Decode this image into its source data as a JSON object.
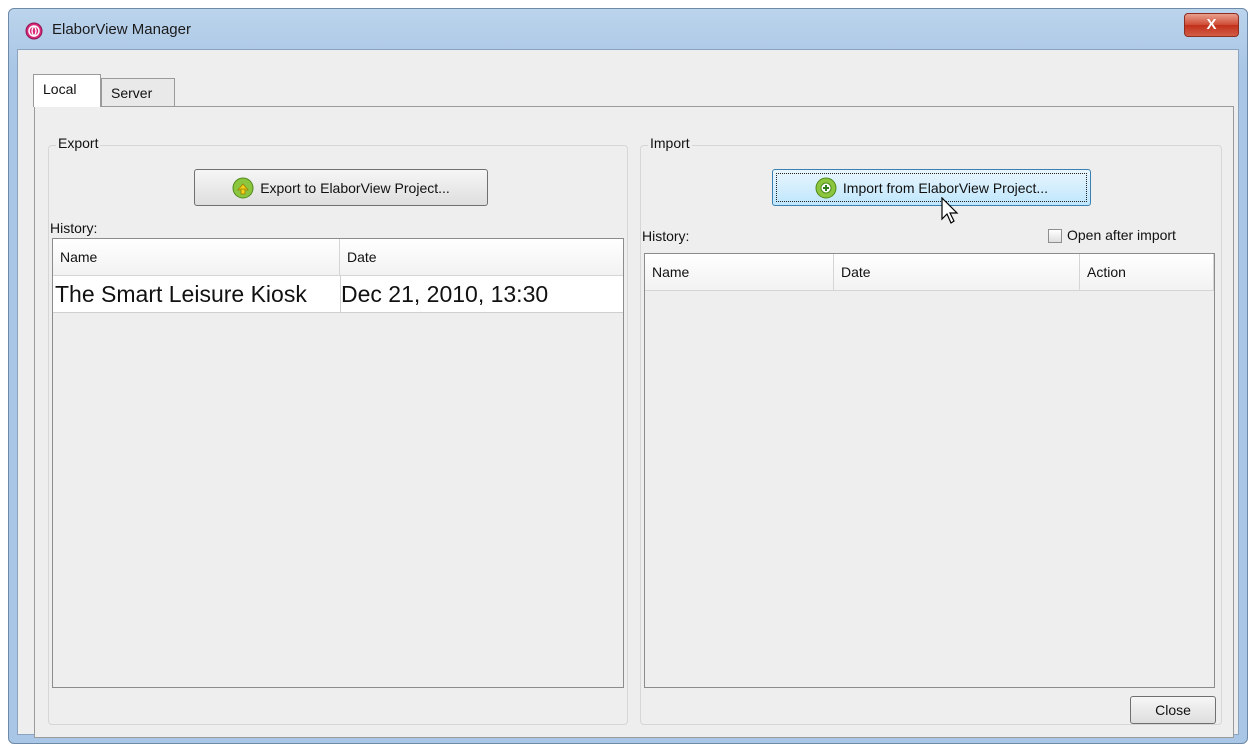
{
  "window": {
    "title": "ElaborView Manager",
    "close_glyph": "X"
  },
  "tabs": [
    {
      "label": "Local",
      "active": true
    },
    {
      "label": "Server",
      "active": false
    }
  ],
  "export": {
    "legend": "Export",
    "button_label": "Export to ElaborView Project...",
    "history_label": "History:",
    "columns": [
      "Name",
      "Date"
    ],
    "rows": [
      {
        "name": "The Smart Leisure Kiosk",
        "date": "Dec 21, 2010, 13:30"
      }
    ]
  },
  "import": {
    "legend": "Import",
    "button_label": "Import from ElaborView Project...",
    "history_label": "History:",
    "open_after_import_label": "Open after import",
    "open_after_import_checked": false,
    "columns": [
      "Name",
      "Date",
      "Action"
    ],
    "rows": []
  },
  "footer": {
    "close_label": "Close"
  },
  "colors": {
    "accent": "#3c7fb1",
    "close_button": "#c2301b"
  },
  "icons": [
    "app-logo-icon",
    "export-project-icon",
    "import-project-icon",
    "mouse-pointer-icon"
  ]
}
